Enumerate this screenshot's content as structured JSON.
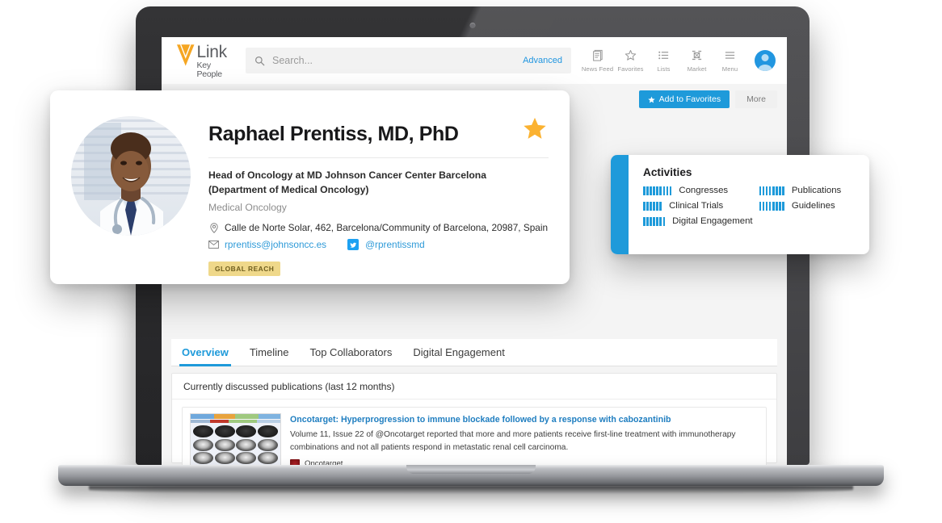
{
  "header": {
    "logo_main": "Link",
    "logo_sub": "Key People",
    "search_placeholder": "Search...",
    "search_value": "",
    "advanced_label": "Advanced",
    "nav": [
      {
        "label": "News Feed",
        "icon": "news-feed-icon"
      },
      {
        "label": "Favorites",
        "icon": "star-outline-icon"
      },
      {
        "label": "Lists",
        "icon": "list-icon"
      },
      {
        "label": "Market",
        "icon": "market-grid-icon"
      },
      {
        "label": "Menu",
        "icon": "hamburger-menu-icon"
      }
    ],
    "avatar": "user-avatar-icon"
  },
  "actions": {
    "add_to_favorites": "Add to Favorites",
    "more": "More"
  },
  "profile": {
    "name": "Raphael Prentiss, MD, PhD",
    "role": "Head of Oncology at MD Johnson Cancer Center Barcelona (Department of Medical Oncology)",
    "role_line1": "Head of Oncology at MD Johnson Cancer Center Barcelona",
    "role_line2": "(Department of Medical Oncology)",
    "specialty": "Medical Oncology",
    "address": "Calle de Norte Solar, 462, Barcelona/Community of Barcelona, 20987, Spain",
    "email": "rprentiss@johnsoncc.es",
    "twitter": "@rprentissmd",
    "badge": "GLOBAL REACH",
    "starred": true
  },
  "activities": {
    "title": "Activities",
    "items": [
      {
        "label": "Congresses",
        "bars": 9
      },
      {
        "label": "Publications",
        "bars": 8
      },
      {
        "label": "Clinical Trials",
        "bars": 6
      },
      {
        "label": "Guidelines",
        "bars": 8
      },
      {
        "label": "Digital Engagement",
        "bars": 7
      }
    ]
  },
  "tabs": [
    {
      "label": "Overview",
      "active": true
    },
    {
      "label": "Timeline",
      "active": false
    },
    {
      "label": "Top Collaborators",
      "active": false
    },
    {
      "label": "Digital Engagement",
      "active": false
    }
  ],
  "panel": {
    "heading": "Currently discussed publications (last 12 months)",
    "publication": {
      "title": "Oncotarget: Hyperprogression to immune blockade followed by a response with cabozantinib",
      "description": "Volume 11, Issue 22 of @Oncotarget reported that more and more patients receive first-line treatment with immunotherapy combinations and not all patients respond in metastatic renal cell carcinoma.",
      "source": "Oncotarget",
      "thumbnail": "ct-scan-grid-image"
    }
  },
  "colors": {
    "accent_blue": "#1e9ada",
    "link_blue": "#2e9ad8",
    "star_orange": "#fbb231",
    "badge_yellow": "#efd88a",
    "source_red": "#8d1519"
  }
}
